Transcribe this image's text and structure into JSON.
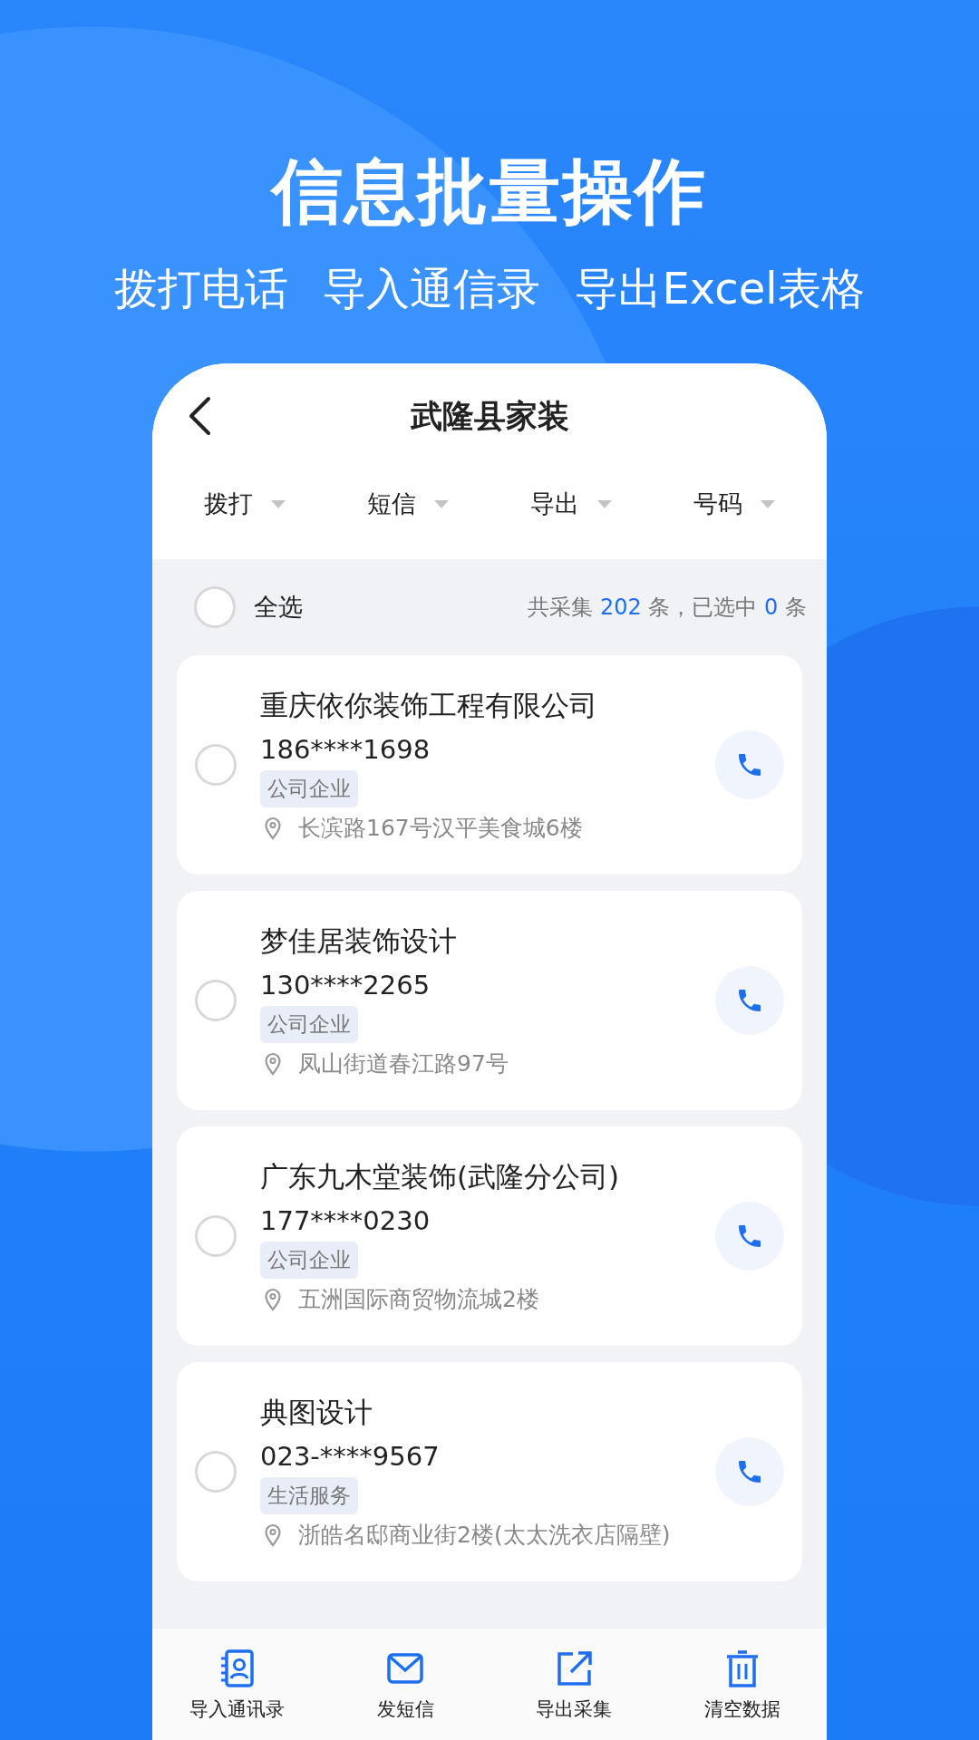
{
  "headline": "信息批量操作",
  "subheadline": [
    {
      "text": "拨打电话"
    },
    {
      "text": "导入通信录"
    },
    {
      "text": "导出Excel表格"
    }
  ],
  "header": {
    "title": "武隆县家装"
  },
  "filters": [
    {
      "label": "拨打"
    },
    {
      "label": "短信"
    },
    {
      "label": "导出"
    },
    {
      "label": "号码"
    }
  ],
  "select_all": {
    "label": "全选",
    "checked": false
  },
  "summary": {
    "prefix": "共采集",
    "total": "202",
    "middle": "条，已选中",
    "selected_count": "0",
    "suffix": "条"
  },
  "contacts": [
    {
      "name": "重庆依你装饰工程有限公司",
      "phone": "186****1698",
      "tag": "公司企业",
      "address": "长滨路167号汉平美食城6楼",
      "checked": false
    },
    {
      "name": "梦佳居装饰设计",
      "phone": "130****2265",
      "tag": "公司企业",
      "address": "凤山街道春江路97号",
      "checked": false
    },
    {
      "name": "广东九木堂装饰(武隆分公司)",
      "phone": "177****0230",
      "tag": "公司企业",
      "address": "五洲国际商贸物流城2楼",
      "checked": false
    },
    {
      "name": "典图设计",
      "phone": "023-****9567",
      "tag": "生活服务",
      "address": "浙皓名邸商业街2楼(太太洗衣店隔壁)",
      "checked": false
    }
  ],
  "bottom_bar": [
    {
      "kind": "contacts",
      "label": "导入通讯录"
    },
    {
      "kind": "mail",
      "label": "发短信"
    },
    {
      "kind": "export",
      "label": "导出采集"
    },
    {
      "kind": "trash",
      "label": "清空数据"
    }
  ]
}
